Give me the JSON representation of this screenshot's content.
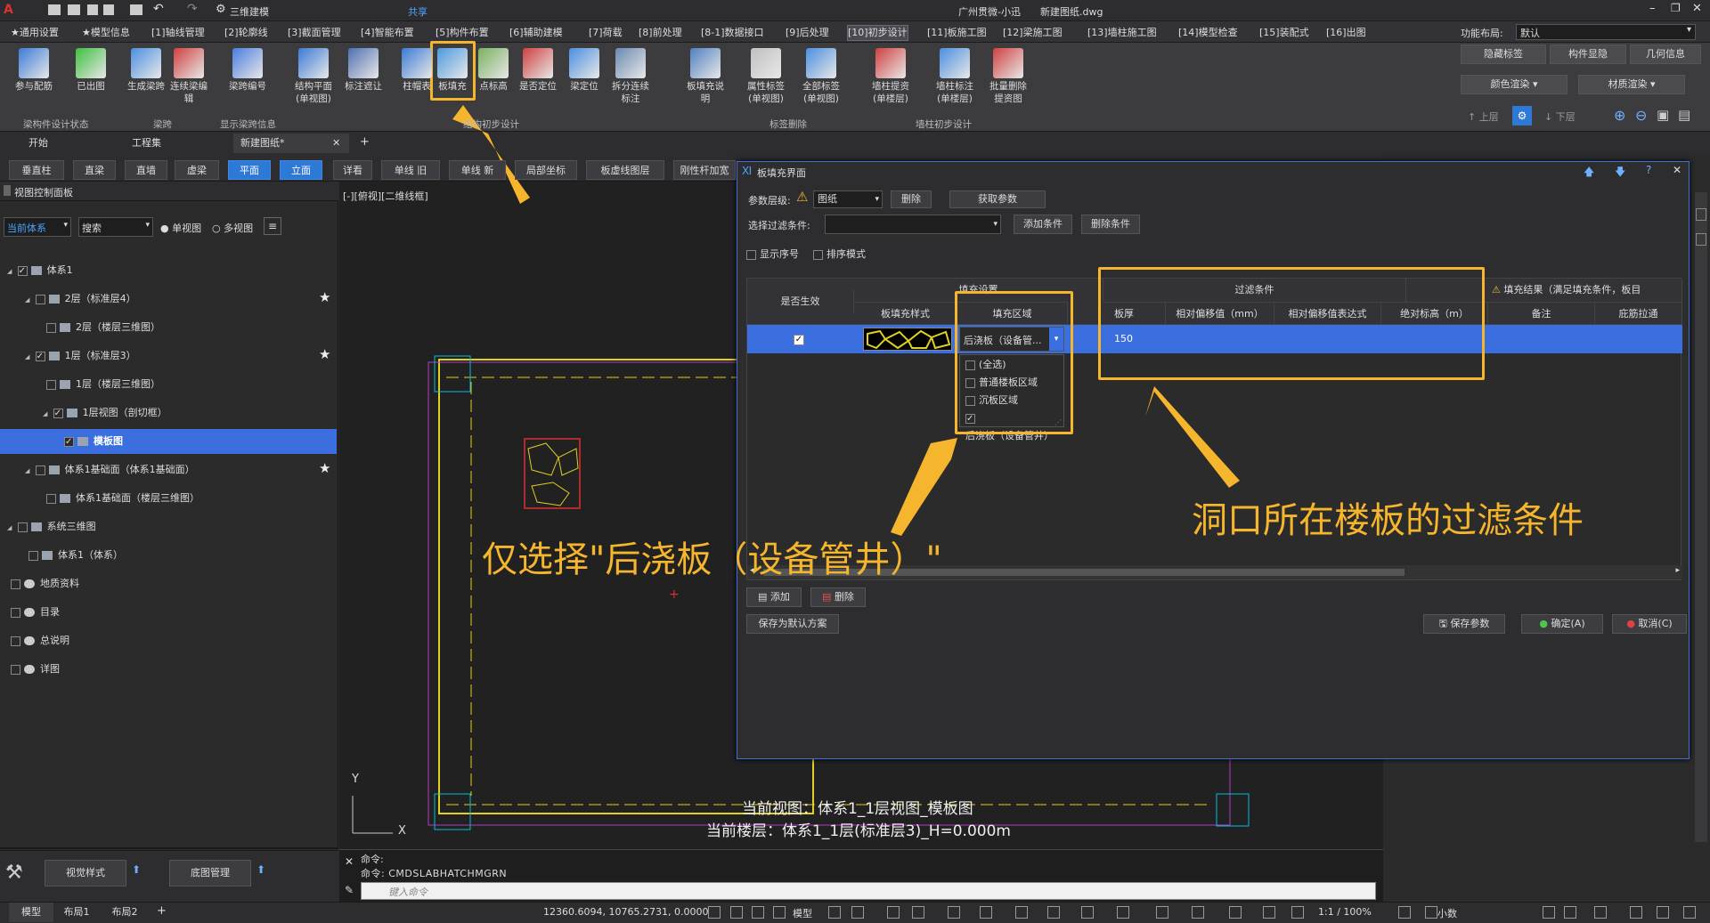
{
  "titlebar": {
    "quick_access_label": "三维建模",
    "share": "共享",
    "app_title": "广州贯微-小迅",
    "doc_title": "新建图纸.dwg"
  },
  "menubar": {
    "items": [
      "★通用设置",
      "★模型信息",
      "[1]轴线管理",
      "[2]轮廓线",
      "[3]截面管理",
      "[4]智能布置",
      "[5]构件布置",
      "[6]辅助建模",
      "[7]荷载",
      "[8]前处理",
      "[8-1]数据接口",
      "[9]后处理",
      "[10]初步设计",
      "[11]板施工图",
      "[12]梁施工图",
      "[13]墙柱施工图",
      "[14]模型检查",
      "[15]装配式",
      "[16]出图"
    ],
    "active_index": 12,
    "layout_label": "功能布局:",
    "layout_value": "默认"
  },
  "ribbon": {
    "buttons": [
      {
        "label": "参与配筋",
        "icon": "rebar-icon"
      },
      {
        "label": "已出图",
        "icon": "check-circle-icon"
      },
      {
        "label": "生成梁跨",
        "icon": "move-arrows-icon"
      },
      {
        "label": "连续梁编辑",
        "icon": "pen-edit-icon"
      },
      {
        "label": "梁跨编号",
        "icon": "number-08-icon"
      },
      {
        "label": "结构平面(单视图)",
        "icon": "plan-edit-icon"
      },
      {
        "label": "标注遮让",
        "icon": "annotate-icon"
      },
      {
        "label": "柱帽表",
        "icon": "table-icon"
      },
      {
        "label": "板填充",
        "icon": "slab-fill-icon"
      },
      {
        "label": "点标高",
        "icon": "point-elevation-icon"
      },
      {
        "label": "是否定位",
        "icon": "locate-check-icon"
      },
      {
        "label": "梁定位",
        "icon": "beam-locate-icon"
      },
      {
        "label": "拆分连续标注",
        "icon": "split-annotate-icon"
      },
      {
        "label": "板填充说明",
        "icon": "grid-table-icon"
      },
      {
        "label": "属性标签(单视图)",
        "icon": "trash-icon"
      },
      {
        "label": "全部标签(单视图)",
        "icon": "tag-icon"
      },
      {
        "label": "墙柱提资(单楼层)",
        "icon": "wall-column-icon"
      },
      {
        "label": "墙柱标注(单楼层)",
        "icon": "wall-annotate-icon"
      },
      {
        "label": "批量删除提资图",
        "icon": "batch-delete-icon"
      }
    ],
    "groups": [
      "梁构件设计状态",
      "梁跨",
      "显示梁跨信息",
      "结构初步设计",
      "标签删除",
      "墙柱初步设计"
    ],
    "right": {
      "hide_label": "隐藏标签",
      "component_display": "构件显隐",
      "geometry_info": "几何信息",
      "color_render": "颜色渲染",
      "material_render": "材质渲染",
      "floor_up": "上层",
      "floor_down": "下层"
    }
  },
  "doctabs": [
    "开始",
    "工程集",
    "新建图纸*"
  ],
  "viewtoolbar": [
    "垂直柱",
    "直梁",
    "直墙",
    "虚梁",
    "平面",
    "立面",
    "详看",
    "单线 旧",
    "单线 新",
    "局部坐标",
    "板虚线图层",
    "刚性杆加宽"
  ],
  "viewtoolbar_selected": [
    4,
    5
  ],
  "leftpanel": {
    "title": "视图控制面板",
    "system_select": "当前体系",
    "search_placeholder": "搜索",
    "single_view": "单视图",
    "multi_view": "多视图",
    "tree": [
      {
        "label": "体系1",
        "indent": 0,
        "checked": true,
        "star": false
      },
      {
        "label": "2层（标准层4）",
        "indent": 1,
        "checked": false,
        "star": true
      },
      {
        "label": "2层（楼层三维图）",
        "indent": 2,
        "checked": false,
        "star": false
      },
      {
        "label": "1层（标准层3）",
        "indent": 1,
        "checked": true,
        "star": true
      },
      {
        "label": "1层（楼层三维图）",
        "indent": 2,
        "checked": false,
        "star": false
      },
      {
        "label": "1层视图（剖切框）",
        "indent": 2,
        "checked": true,
        "star": false
      },
      {
        "label": "模板图",
        "indent": 3,
        "checked": true,
        "star": false,
        "selected": true
      },
      {
        "label": "体系1基础面（体系1基础面）",
        "indent": 1,
        "checked": false,
        "star": true
      },
      {
        "label": "体系1基础面（楼层三维图）",
        "indent": 2,
        "checked": false,
        "star": false
      },
      {
        "label": "系统三维图",
        "indent": 0,
        "checked": false,
        "star": false
      },
      {
        "label": "体系1（体系）",
        "indent": 1,
        "checked": false,
        "star": false
      },
      {
        "label": "地质资料",
        "indent": 0,
        "checked": false,
        "star": false
      },
      {
        "label": "目录",
        "indent": 0,
        "checked": false,
        "star": false
      },
      {
        "label": "总说明",
        "indent": 0,
        "checked": false,
        "star": false
      },
      {
        "label": "详图",
        "indent": 0,
        "checked": false,
        "star": false
      }
    ],
    "bottom_buttons": [
      "视觉样式",
      "底图管理"
    ]
  },
  "canvas": {
    "viewport_label": "[-][俯视][二维线框]",
    "current_view": "当前视图：体系1_1层视图_模板图",
    "current_floor": "当前楼层：体系1_1层(标准层3)_H=0.000m",
    "axis_y": "Y",
    "axis_x": "X"
  },
  "command": {
    "line1": "命令:",
    "line2": "命令:  CMDSLABHATCHMGRN",
    "input_placeholder": "键入命令"
  },
  "dialog": {
    "title": "板填充界面",
    "param_level_label": "参数层级:",
    "param_level_value": "图纸",
    "delete": "删除",
    "get_params": "获取参数",
    "filter_label": "选择过滤条件:",
    "add_condition": "添加条件",
    "delete_condition": "删除条件",
    "show_seq": "显示序号",
    "sort_mode": "排序模式",
    "group_fill": "填充设置",
    "group_filter": "过滤条件",
    "group_result": "填充结果（满足填充条件，板目",
    "columns": [
      "是否生效",
      "板填充样式",
      "填充区域",
      "板厚",
      "相对偏移值（mm）",
      "相对偏移值表达式",
      "绝对标高（m）",
      "备注",
      "庇筋拉通"
    ],
    "row": {
      "effective": true,
      "region": "后浇板（设备管...",
      "thickness": "150"
    },
    "dropdown_options": [
      {
        "label": "(全选)",
        "checked": false
      },
      {
        "label": "普通楼板区域",
        "checked": false
      },
      {
        "label": "沉板区域",
        "checked": false
      },
      {
        "label": "后浇板（设备管井）",
        "checked": true
      }
    ],
    "add": "添加",
    "remove": "删除",
    "save_default": "保存为默认方案",
    "save_params": "保存参数",
    "ok": "确定(A)",
    "cancel": "取消(C)"
  },
  "annotations": {
    "left_text": "仅选择\"后浇板（设备管井）\"",
    "right_text": "洞口所在楼板的过滤条件",
    "color": "#f5b52c"
  },
  "statusbar": {
    "layouts": [
      "模型",
      "布局1",
      "布局2"
    ],
    "coords": "12360.6094, 10765.2731, 0.0000",
    "model": "模型",
    "scale": "1:1 / 100%",
    "unit": "小数"
  }
}
